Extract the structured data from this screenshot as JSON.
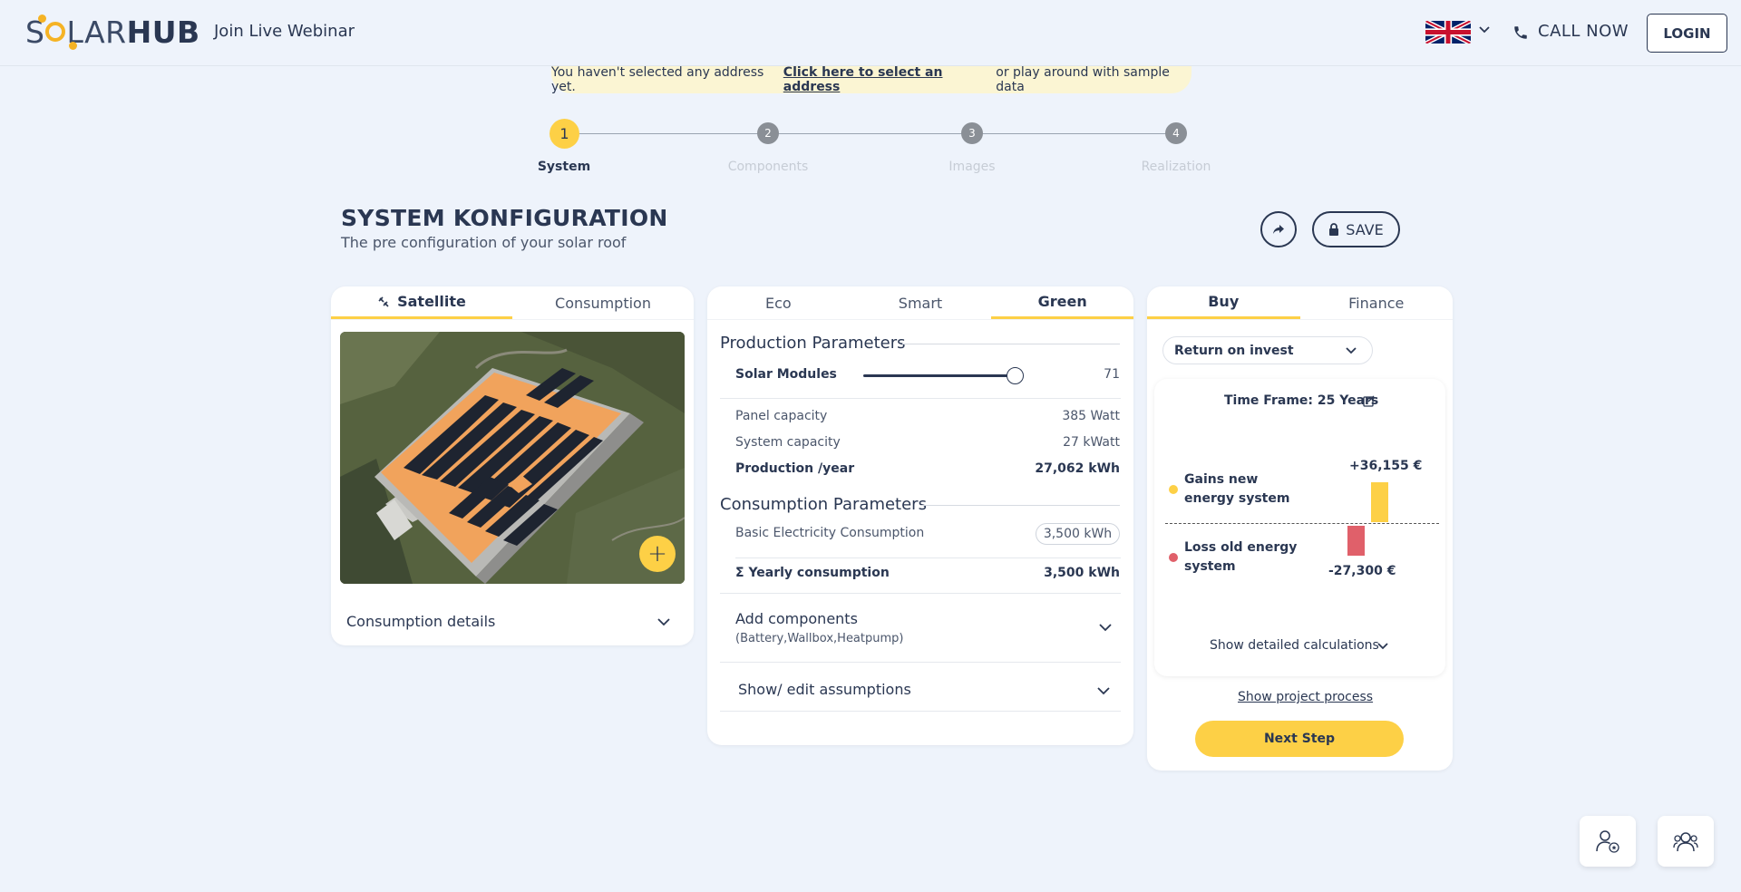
{
  "header": {
    "logo_part1": "S",
    "logo_part2": "LAR",
    "logo_part3": "HUB",
    "webinar": "Join Live Webinar",
    "call_now": "CALL NOW",
    "login": "LOGIN"
  },
  "notice": {
    "before": "You haven't selected any address yet.",
    "link": "Click here to select an address",
    "after": "or play around with sample data"
  },
  "steps": [
    {
      "num": "1",
      "label": "System"
    },
    {
      "num": "2",
      "label": "Components"
    },
    {
      "num": "3",
      "label": "Images"
    },
    {
      "num": "4",
      "label": "Realization"
    }
  ],
  "page": {
    "title": "SYSTEM KONFIGURATION",
    "subtitle": "The pre configuration of your solar roof",
    "save": "SAVE"
  },
  "left_card": {
    "tabs": [
      "Satellite",
      "Consumption"
    ],
    "consumption_details": "Consumption details"
  },
  "middle_card": {
    "tabs": [
      "Eco",
      "Smart",
      "Green"
    ],
    "production_title": "Production Parameters",
    "solar_modules_label": "Solar Modules",
    "solar_modules_value": "71",
    "solar_modules_fraction": 0.89,
    "panel_capacity_label": "Panel capacity",
    "panel_capacity_value": "385 Watt",
    "system_capacity_label": "System capacity",
    "system_capacity_value": "27 kWatt",
    "production_label": "Production /year",
    "production_value": "27,062 kWh",
    "consumption_title": "Consumption Parameters",
    "basic_label": "Basic Electricity Consumption",
    "basic_value": "3,500 kWh",
    "yearly_label": "Σ  Yearly consumption",
    "yearly_value": "3,500 kWh",
    "add_components": "Add components",
    "add_components_sub": "(Battery,Wallbox,Heatpump)",
    "assumptions": "Show/ edit assumptions"
  },
  "right_card": {
    "tabs": [
      "Buy",
      "Finance"
    ],
    "select_value": "Return on invest",
    "timeframe": "Time Frame: 25 Years",
    "gains_label": "Gains new energy system",
    "gains_value": "+36,155 €",
    "loss_label": "Loss old energy system",
    "loss_value": "-27,300 €",
    "show_calc": "Show detailed calculations",
    "project": "Show project process",
    "next": "Next Step"
  },
  "colors": {
    "accent": "#fdd046",
    "text": "#2a3752",
    "loss": "#e0606a",
    "gain": "#fdd046",
    "background": "#eef3fb"
  }
}
